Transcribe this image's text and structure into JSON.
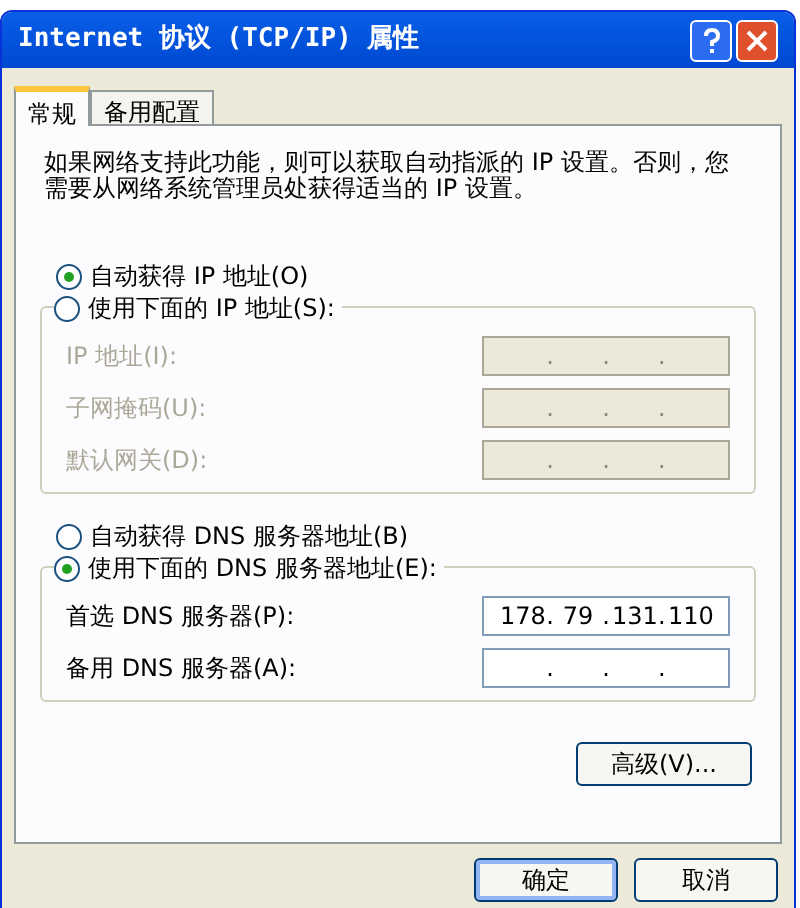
{
  "window": {
    "title": "Internet 协议 (TCP/IP) 属性"
  },
  "tabs": [
    {
      "label": "常规",
      "selected": true
    },
    {
      "label": "备用配置",
      "selected": false
    }
  ],
  "description": "如果网络支持此功能，则可以获取自动指派的 IP 设置。否则，您需要从网络系统管理员处获得适当的 IP 设置。",
  "separator": ".",
  "ip_section": {
    "options": [
      {
        "label": "自动获得 IP 地址(O)",
        "selected": true
      },
      {
        "label": "使用下面的 IP 地址(S):",
        "selected": false
      }
    ],
    "fields": [
      {
        "label": "IP 地址(I):",
        "disabled": true
      },
      {
        "label": "子网掩码(U):",
        "disabled": true
      },
      {
        "label": "默认网关(D):",
        "disabled": true
      }
    ]
  },
  "dns_section": {
    "options": [
      {
        "label": "自动获得 DNS 服务器地址(B)",
        "selected": false
      },
      {
        "label": "使用下面的 DNS 服务器地址(E):",
        "selected": true
      }
    ],
    "fields": [
      {
        "label": "首选 DNS 服务器(P):",
        "disabled": false,
        "octets": [
          "178",
          "79",
          "131",
          "110"
        ]
      },
      {
        "label": "备用 DNS 服务器(A):",
        "disabled": false
      }
    ]
  },
  "advanced_button": "高级(V)...",
  "buttons": [
    {
      "label": "确定",
      "default": true
    },
    {
      "label": "取消",
      "default": false
    }
  ]
}
